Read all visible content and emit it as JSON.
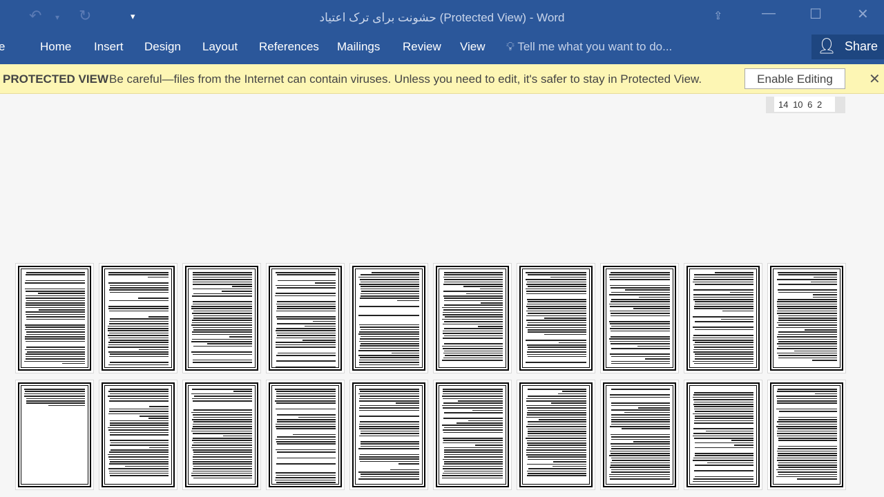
{
  "titlebar": {
    "title": "حشونت برای ترک اعتیاد (Protected View) - Word",
    "undo_icon": "undo-icon",
    "redo_icon": "redo-icon",
    "customize_icon": "customize-quick-access-icon",
    "ribbon_display_icon": "ribbon-display-options-icon",
    "minimize_icon": "minimize-icon",
    "maximize_icon": "maximize-icon",
    "close_icon": "close-icon"
  },
  "ribbon": {
    "tabs": [
      "e",
      "Home",
      "Insert",
      "Design",
      "Layout",
      "References",
      "Mailings",
      "Review",
      "View"
    ],
    "tell_me": "Tell me what you want to do...",
    "share": "Share"
  },
  "protected_view": {
    "label": "PROTECTED VIEW",
    "message": "Be careful—files from the Internet can contain viruses. Unless you need to edit, it's safer to stay in Protected View.",
    "enable_button": "Enable Editing"
  },
  "ruler": {
    "values": "14 10 6 2"
  },
  "document": {
    "rows": 2,
    "pages_per_row": 10
  }
}
